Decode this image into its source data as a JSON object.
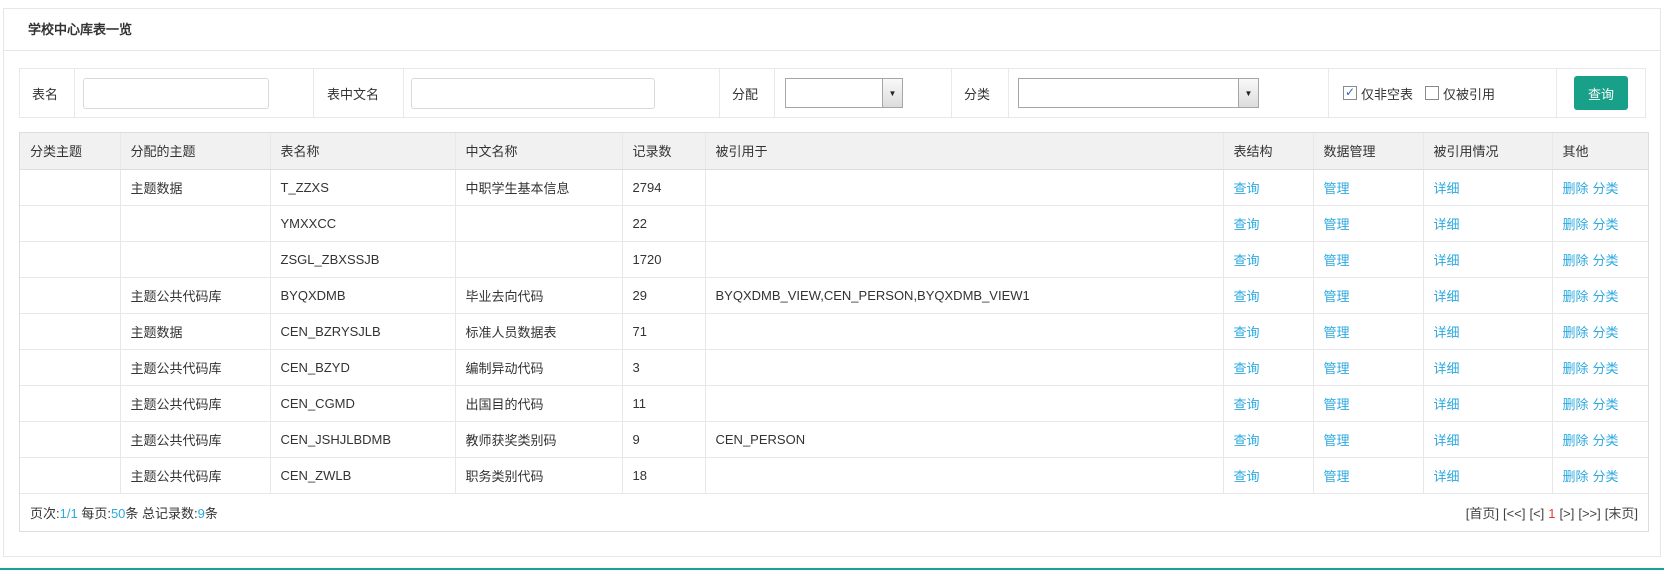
{
  "page": {
    "title": "学校中心库表一览"
  },
  "filters": {
    "table_name_label": "表名",
    "table_name_value": "",
    "table_cn_label": "表中文名",
    "table_cn_value": "",
    "assign_label": "分配",
    "assign_value": "",
    "category_label": "分类",
    "category_value": "",
    "nonempty_label": "仅非空表",
    "nonempty_checked": true,
    "referenced_label": "仅被引用",
    "referenced_checked": false,
    "query_button": "查询"
  },
  "table": {
    "headers": [
      "分类主题",
      "分配的主题",
      "表名称",
      "中文名称",
      "记录数",
      "被引用于",
      "表结构",
      "数据管理",
      "被引用情况",
      "其他"
    ],
    "row_actions": {
      "structure_link": "查询",
      "data_link": "管理",
      "referenced_link": "详细",
      "delete_link": "删除",
      "classify_link": "分类"
    },
    "rows": [
      {
        "category_topic": "",
        "assigned_topic": "主题数据",
        "table_name": "T_ZZXS",
        "cn_name": "中职学生基本信息",
        "record_count": "2794",
        "referenced_by": ""
      },
      {
        "category_topic": "",
        "assigned_topic": "",
        "table_name": "YMXXCC",
        "cn_name": "",
        "record_count": "22",
        "referenced_by": ""
      },
      {
        "category_topic": "",
        "assigned_topic": "",
        "table_name": "ZSGL_ZBXSSJB",
        "cn_name": "",
        "record_count": "1720",
        "referenced_by": ""
      },
      {
        "category_topic": "",
        "assigned_topic": "主题公共代码库",
        "table_name": "BYQXDMB",
        "cn_name": "毕业去向代码",
        "record_count": "29",
        "referenced_by": "BYQXDMB_VIEW,CEN_PERSON,BYQXDMB_VIEW1"
      },
      {
        "category_topic": "",
        "assigned_topic": "主题数据",
        "table_name": "CEN_BZRYSJLB",
        "cn_name": "标准人员数据表",
        "record_count": "71",
        "referenced_by": ""
      },
      {
        "category_topic": "",
        "assigned_topic": "主题公共代码库",
        "table_name": "CEN_BZYD",
        "cn_name": "编制异动代码",
        "record_count": "3",
        "referenced_by": ""
      },
      {
        "category_topic": "",
        "assigned_topic": "主题公共代码库",
        "table_name": "CEN_CGMD",
        "cn_name": "出国目的代码",
        "record_count": "11",
        "referenced_by": ""
      },
      {
        "category_topic": "",
        "assigned_topic": "主题公共代码库",
        "table_name": "CEN_JSHJLBDMB",
        "cn_name": "教师获奖类别码",
        "record_count": "9",
        "referenced_by": "CEN_PERSON"
      },
      {
        "category_topic": "",
        "assigned_topic": "主题公共代码库",
        "table_name": "CEN_ZWLB",
        "cn_name": "职务类别代码",
        "record_count": "18",
        "referenced_by": ""
      }
    ]
  },
  "footer": {
    "segments": [
      {
        "t": "页次:"
      },
      {
        "t": "1/1",
        "b": true
      },
      {
        "t": " 每页:"
      },
      {
        "t": "50",
        "b": true
      },
      {
        "t": "条 总记录数:"
      },
      {
        "t": "9",
        "b": true
      },
      {
        "t": "条"
      }
    ],
    "pagination": [
      {
        "label": "[首页]",
        "current": false
      },
      {
        "label": "[<<]",
        "current": false
      },
      {
        "label": "[<]",
        "current": false
      },
      {
        "label": "1",
        "current": true
      },
      {
        "label": "[>]",
        "current": false
      },
      {
        "label": "[>>]",
        "current": false
      },
      {
        "label": "[末页]",
        "current": false
      }
    ]
  },
  "colors": {
    "accent_teal": "#18a089",
    "link_blue": "#2ba9e0",
    "current_page_red": "#e4393c",
    "header_bg": "#f1f1f1",
    "border": "#e7e7e7"
  }
}
